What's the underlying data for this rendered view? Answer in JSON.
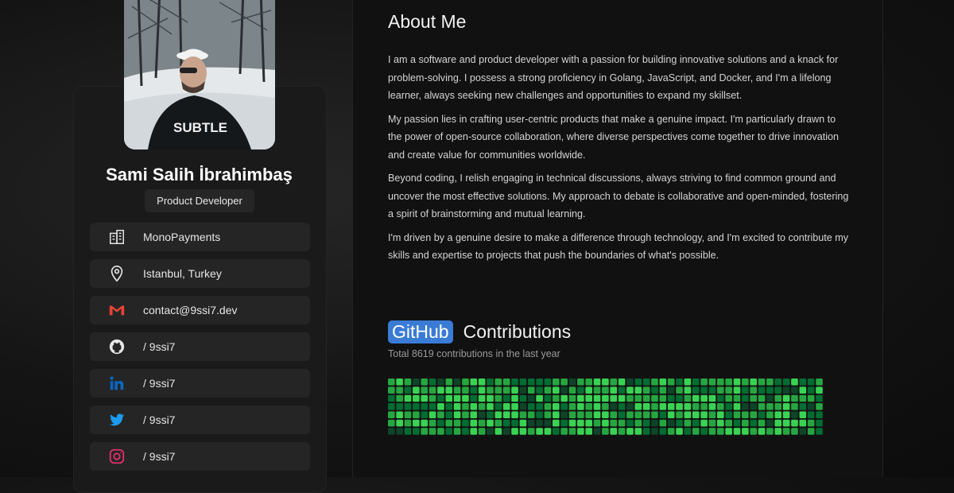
{
  "about": {
    "title": "About Me",
    "paragraphs": [
      "I am a software and product developer with a passion for building innovative solutions and a knack for problem-solving. I possess a strong proficiency in Golang, JavaScript, and Docker, and I'm a lifelong learner, always seeking new challenges and opportunities to expand my skillset.",
      "My passion lies in crafting user-centric products that make a genuine impact. I'm particularly drawn to the power of open-source collaboration, where diverse perspectives come together to drive innovation and create value for communities worldwide.",
      "Beyond coding, I relish engaging in technical discussions, always striving to find common ground and uncover the most effective solutions. My approach to debate is collaborative and open-minded, fostering a spirit of brainstorming and mutual learning.",
      "I'm driven by a genuine desire to make a difference through technology, and I'm excited to contribute my skills and expertise to projects that push the boundaries of what's possible."
    ]
  },
  "github": {
    "badge": "GitHub",
    "title_rest": "Contributions",
    "total_text": "Total 8619 contributions in the last year",
    "palette": [
      "#0e4429",
      "#006d32",
      "#26a641",
      "#39d353"
    ]
  },
  "profile": {
    "name": "Sami Salih İbrahimbaş",
    "role": "Product Developer",
    "links": [
      {
        "icon": "building-icon",
        "text": "MonoPayments",
        "color": "#e6e6e6"
      },
      {
        "icon": "location-pin-icon",
        "text": "Istanbul, Turkey",
        "color": "#e6e6e6"
      },
      {
        "icon": "gmail-icon",
        "text": "contact@9ssi7.dev",
        "color": "#ea4335"
      },
      {
        "icon": "github-icon",
        "text": "/ 9ssi7",
        "color": "#e6e6e6"
      },
      {
        "icon": "linkedin-icon",
        "text": "/ 9ssi7",
        "color": "#0a66c2"
      },
      {
        "icon": "twitter-icon",
        "text": "/ 9ssi7",
        "color": "#1d9bf0"
      },
      {
        "icon": "instagram-icon",
        "text": "/ 9ssi7",
        "color": "#e1306c"
      }
    ]
  }
}
